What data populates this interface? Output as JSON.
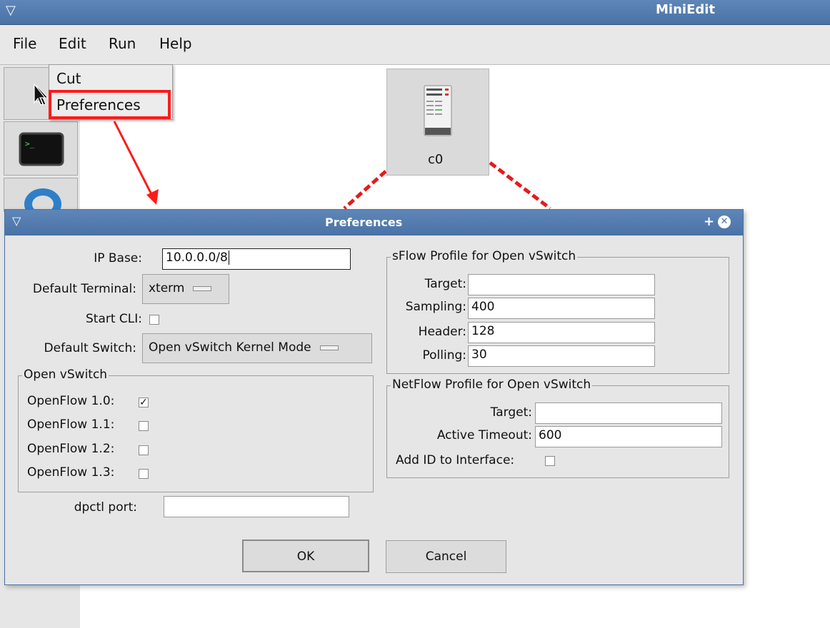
{
  "app": {
    "title": "MiniEdit"
  },
  "menubar": {
    "items": [
      "File",
      "Edit",
      "Run",
      "Help"
    ]
  },
  "edit_menu": {
    "items": [
      "Cut",
      "Preferences"
    ]
  },
  "canvas": {
    "controller_label": "c0"
  },
  "dialog": {
    "title": "Preferences",
    "ip_base": {
      "label": "IP Base:",
      "value": "10.0.0.0/8"
    },
    "default_terminal": {
      "label": "Default Terminal:",
      "value": "xterm"
    },
    "start_cli": {
      "label": "Start CLI:",
      "checked": false
    },
    "default_switch": {
      "label": "Default Switch:",
      "value": "Open vSwitch Kernel Mode"
    },
    "openvswitch": {
      "legend": "Open vSwitch",
      "items": [
        {
          "label": "OpenFlow 1.0:",
          "checked": true
        },
        {
          "label": "OpenFlow 1.1:",
          "checked": false
        },
        {
          "label": "OpenFlow 1.2:",
          "checked": false
        },
        {
          "label": "OpenFlow 1.3:",
          "checked": false
        }
      ]
    },
    "dpctl_port": {
      "label": "dpctl port:",
      "value": ""
    },
    "sflow": {
      "legend": "sFlow Profile for Open vSwitch",
      "fields": [
        {
          "label": "Target:",
          "value": ""
        },
        {
          "label": "Sampling:",
          "value": "400"
        },
        {
          "label": "Header:",
          "value": "128"
        },
        {
          "label": "Polling:",
          "value": "30"
        }
      ]
    },
    "netflow": {
      "legend": "NetFlow Profile for Open vSwitch",
      "target": {
        "label": "Target:",
        "value": ""
      },
      "active_timeout": {
        "label": "Active Timeout:",
        "value": "600"
      },
      "add_id": {
        "label": "Add ID to Interface:",
        "checked": false
      }
    },
    "buttons": {
      "ok": "OK",
      "cancel": "Cancel"
    }
  },
  "colors": {
    "titlebar": "#4a72a6",
    "highlight": "#ff1a1a"
  }
}
